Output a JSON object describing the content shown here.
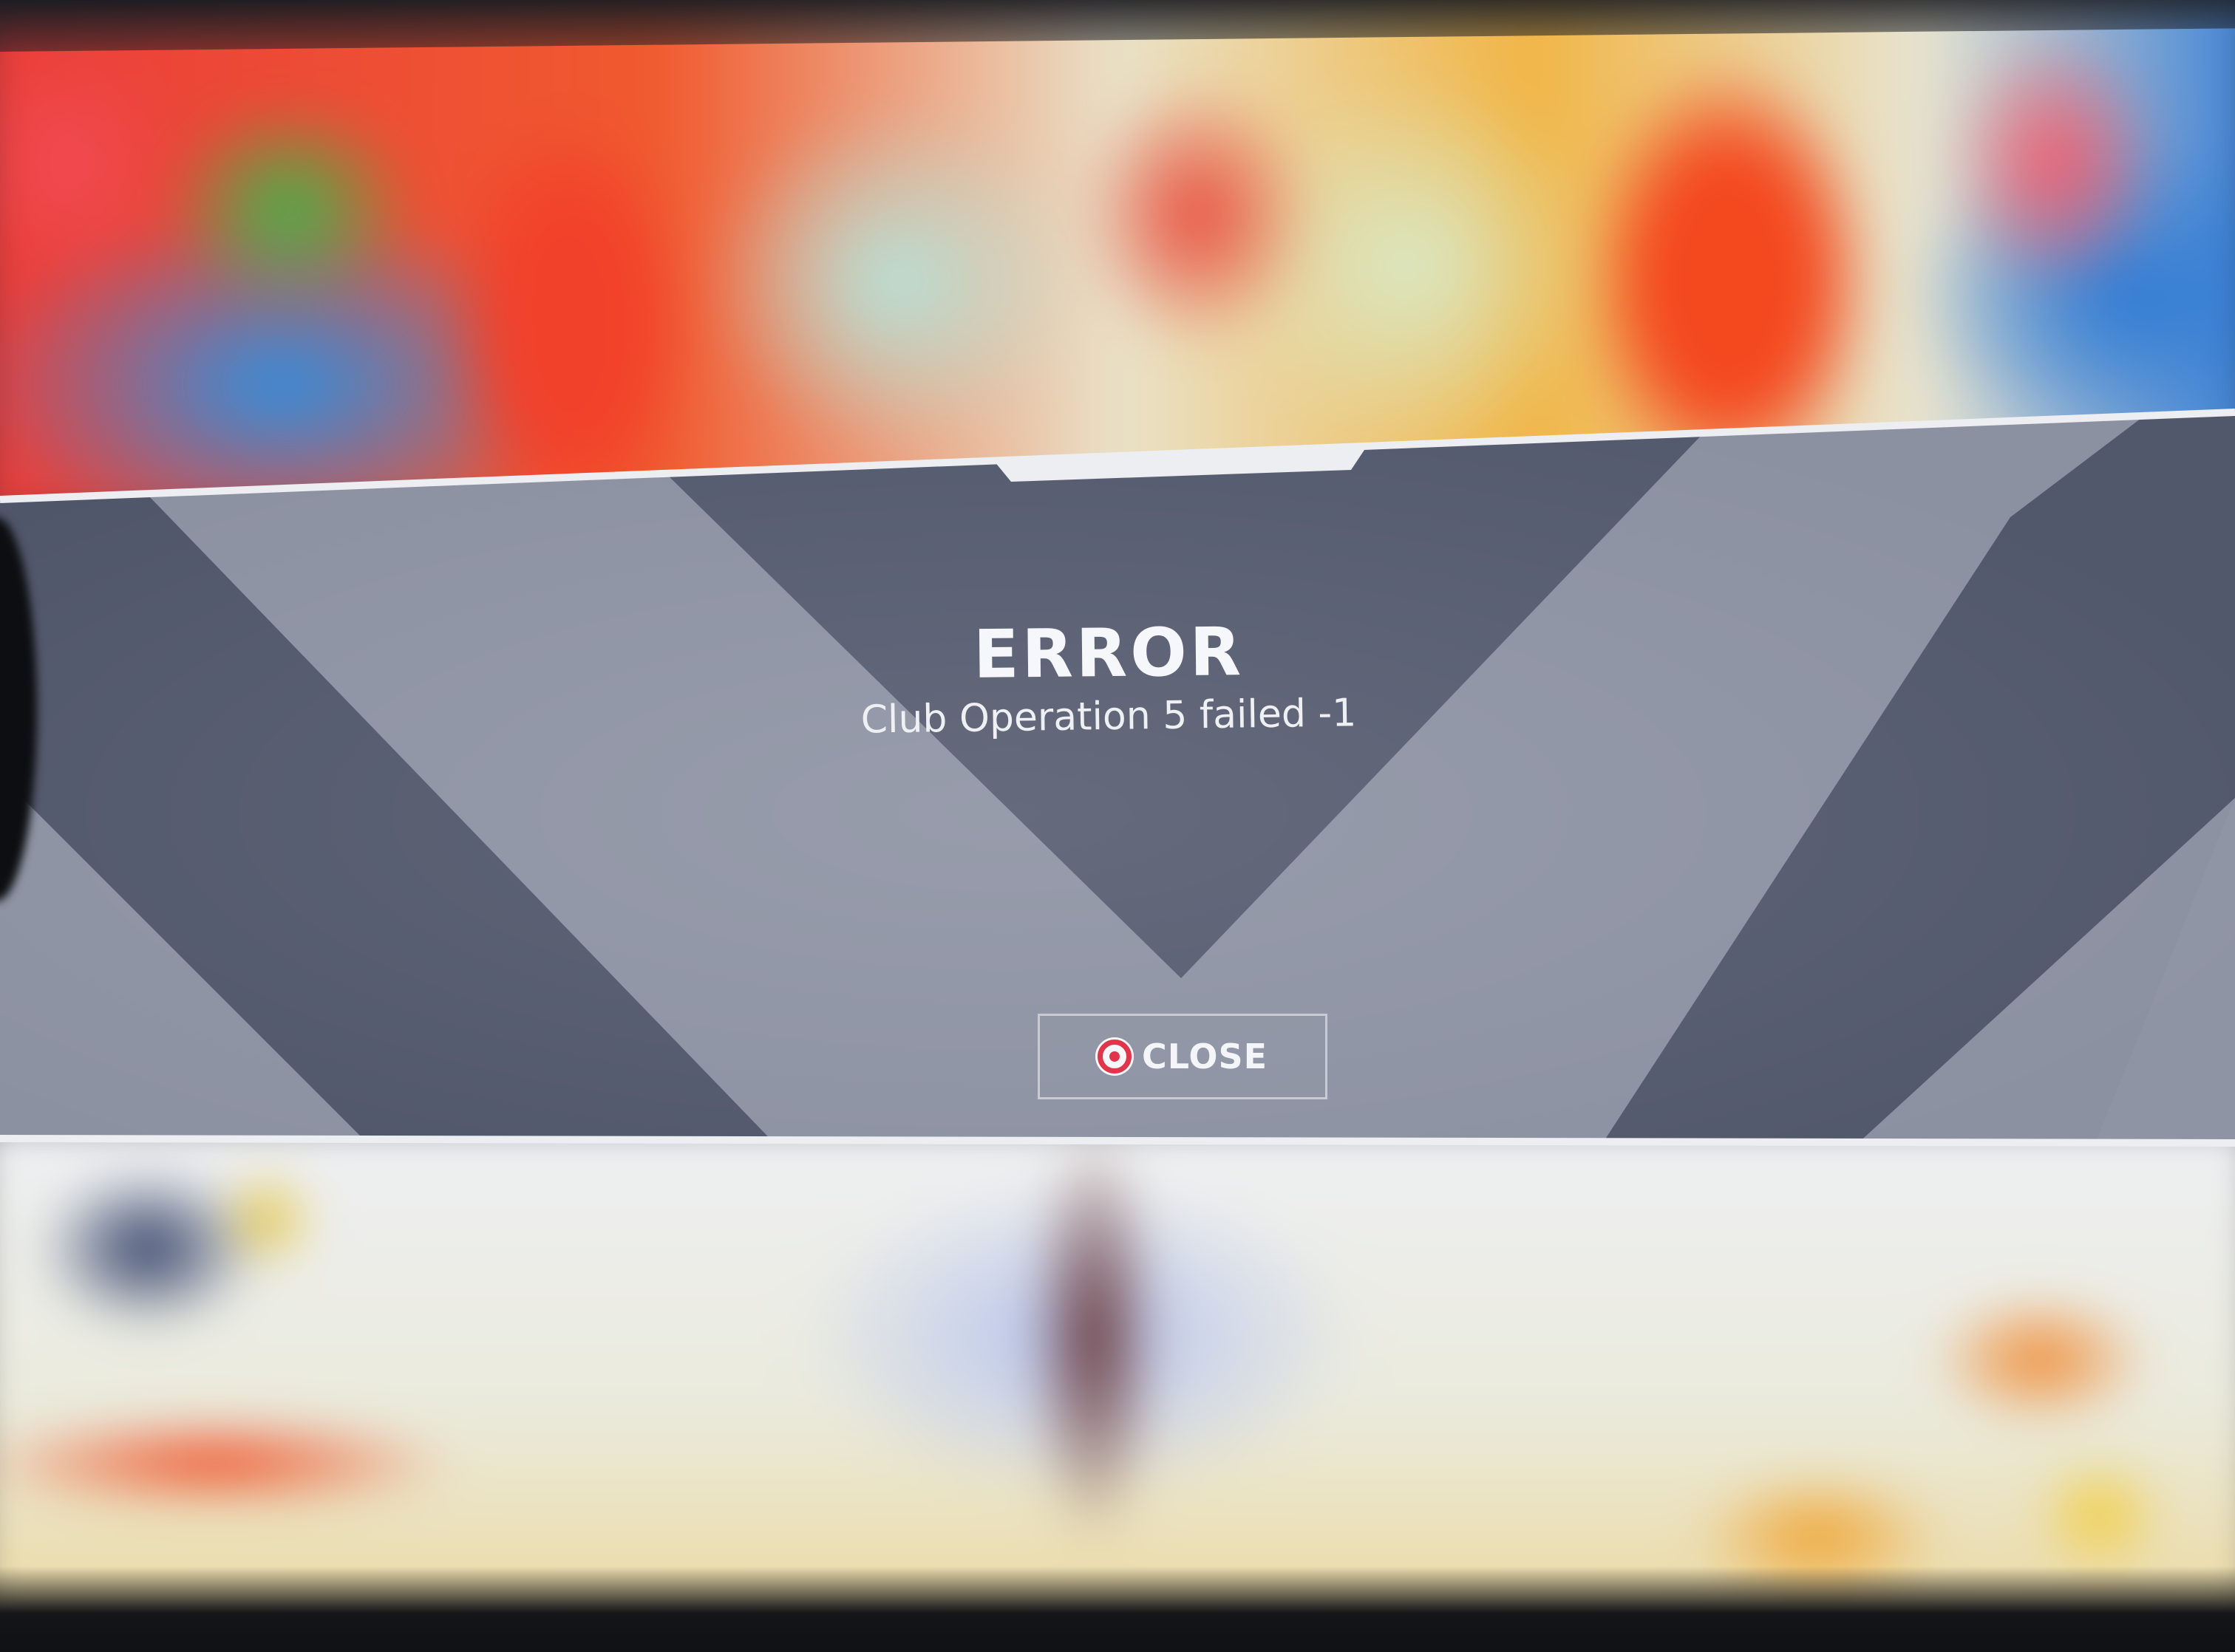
{
  "dialog": {
    "title": "ERROR",
    "message": "Club Operation 5 failed -1"
  },
  "close_button": {
    "label": "CLOSE",
    "icon": "circle-button-icon"
  },
  "colors": {
    "banner_light": "#8e93a3",
    "banner_dark": "#545a6d",
    "button_icon_red": "#e0354a",
    "text": "#f6f7fa"
  }
}
